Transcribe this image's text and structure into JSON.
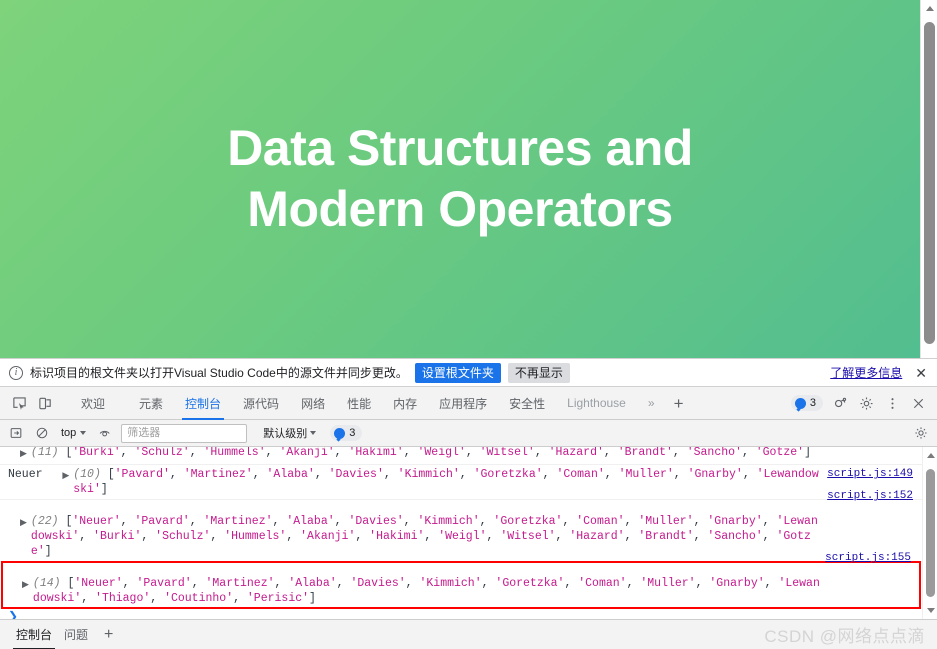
{
  "page": {
    "hero_title": "Data Structures and Modern Operators",
    "gradient_start": "#7ed37b",
    "gradient_end": "#52bd90"
  },
  "infobar": {
    "icon": "info-circle-icon",
    "message": "标识项目的根文件夹以打开Visual Studio Code中的源文件并同步更改。",
    "primary_button": "设置根文件夹",
    "secondary_button": "不再显示",
    "link": "了解更多信息",
    "close": "✕"
  },
  "devtools_tabs": {
    "items": [
      {
        "label": "欢迎",
        "state": "normal"
      },
      {
        "label": "元素",
        "state": "normal"
      },
      {
        "label": "控制台",
        "state": "active"
      },
      {
        "label": "源代码",
        "state": "normal"
      },
      {
        "label": "网络",
        "state": "normal"
      },
      {
        "label": "性能",
        "state": "normal"
      },
      {
        "label": "内存",
        "state": "normal"
      },
      {
        "label": "应用程序",
        "state": "normal"
      },
      {
        "label": "安全性",
        "state": "normal"
      },
      {
        "label": "Lighthouse",
        "state": "muted"
      }
    ],
    "more": "»",
    "add": "+",
    "issues_count": "3",
    "icons": {
      "inspect": "inspect-element-icon",
      "device": "device-toolbar-icon",
      "issues": "issues-badge-icon",
      "settings": "gear-icon",
      "more_options": "kebab-menu-icon",
      "close": "close-icon",
      "customize": "customize-icon"
    }
  },
  "console_toolbar": {
    "clear_icon": "clear-console-icon",
    "no_entry_icon": "no-entry-icon",
    "context": "top",
    "eye_icon": "live-expression-icon",
    "filter_placeholder": "筛选器",
    "filter_value": "",
    "level": "默认级别",
    "issues_count": "3",
    "settings_icon": "gear-icon"
  },
  "console_log": {
    "rows": [
      {
        "id": "row-11",
        "prefix": "",
        "length": "(11)",
        "items": [
          "'Burki'",
          "'Schulz'",
          "'Hummels'",
          "'Akanji'",
          "'Hakimi'",
          "'Weigl'",
          "'Witsel'",
          "'Hazard'",
          "'Brandt'",
          "'Sancho'",
          "'Gotze'"
        ],
        "source": ""
      },
      {
        "id": "row-10",
        "prefix": "Neuer",
        "length": "(10)",
        "items": [
          "'Pavard'",
          "'Martinez'",
          "'Alaba'",
          "'Davies'",
          "'Kimmich'",
          "'Goretzka'",
          "'Coman'",
          "'Muller'",
          "'Gnarby'",
          "'Lewandowski'"
        ],
        "source": "script.js:149"
      },
      {
        "id": "row-22",
        "prefix": "",
        "length": "(22)",
        "items": [
          "'Neuer'",
          "'Pavard'",
          "'Martinez'",
          "'Alaba'",
          "'Davies'",
          "'Kimmich'",
          "'Goretzka'",
          "'Coman'",
          "'Muller'",
          "'Gnarby'",
          "'Lewandowski'",
          "'Burki'",
          "'Schulz'",
          "'Hummels'",
          "'Akanji'",
          "'Hakimi'",
          "'Weigl'",
          "'Witsel'",
          "'Hazard'",
          "'Brandt'",
          "'Sancho'",
          "'Gotze'"
        ],
        "source": "script.js:152"
      },
      {
        "id": "row-14",
        "prefix": "",
        "length": "(14)",
        "items": [
          "'Neuer'",
          "'Pavard'",
          "'Martinez'",
          "'Alaba'",
          "'Davies'",
          "'Kimmich'",
          "'Goretzka'",
          "'Coman'",
          "'Muller'",
          "'Gnarby'",
          "'Lewandowski'",
          "'Thiago'",
          "'Coutinho'",
          "'Perisic'"
        ],
        "source": "script.js:155",
        "highlighted": true
      }
    ],
    "prompt": "❯",
    "highlight_color": "#ff0000",
    "string_color": "#c41a8d",
    "link_color": "#1a0dab"
  },
  "drawer": {
    "tabs": [
      {
        "label": "控制台",
        "active": true
      },
      {
        "label": "问题",
        "active": false
      }
    ],
    "add": "+",
    "watermark": "CSDN @网络点点滴"
  }
}
